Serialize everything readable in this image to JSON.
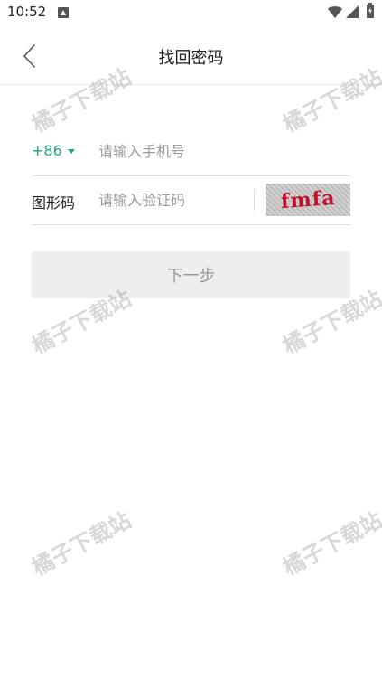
{
  "status_bar": {
    "time": "10:52",
    "icons": [
      "app-notification-icon",
      "wifi-icon",
      "signal-icon",
      "battery-charging-icon"
    ]
  },
  "header": {
    "title": "找回密码",
    "back_icon": "chevron-left-icon"
  },
  "form": {
    "phone": {
      "country_code": "+86",
      "placeholder": "请输入手机号",
      "value": ""
    },
    "captcha": {
      "label": "图形码",
      "placeholder": "请输入验证码",
      "value": "",
      "image_text": "fmfa"
    }
  },
  "next_button": {
    "label": "下一步"
  },
  "watermark": {
    "text": "橘子下载站"
  },
  "colors": {
    "accent": "#1ba784",
    "disabled_button_bg": "#eeeeee",
    "disabled_button_text": "#999999",
    "captcha_text": "#c0102a"
  }
}
